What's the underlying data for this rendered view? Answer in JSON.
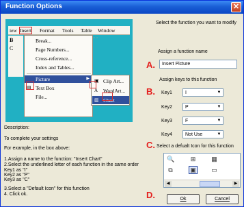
{
  "window": {
    "title": "Function Options",
    "close_glyph": "✕"
  },
  "preview": {
    "menubar": [
      "iew",
      "Insert",
      "Format",
      "Tools",
      "Table",
      "Window"
    ],
    "toolbar_left": [
      "B",
      "C"
    ],
    "menu_items": [
      "Break...",
      "Page Numbers...",
      "Cross-reference...",
      "Index and Tables...",
      "Picture",
      "Text Box",
      "File..."
    ],
    "submenu_items": [
      "Clip Art...",
      "WordArt...",
      "Chart"
    ]
  },
  "right": {
    "instruction": "Select the function you want to modify",
    "assign_name_label": "Assign a function name",
    "function_name_value": "Insert Picture",
    "assign_keys_label": "Assign keys to this function",
    "keys": [
      {
        "label": "Key1",
        "value": "I"
      },
      {
        "label": "Key2",
        "value": "P"
      },
      {
        "label": "Key3",
        "value": "F"
      },
      {
        "label": "Key4",
        "value": "Not Use"
      }
    ],
    "icon_label": "Select a defualt  Icon for this function",
    "letters": [
      "A.",
      "B.",
      "C.",
      "D."
    ],
    "ok_label": "Ok",
    "cancel_label": "Cancel"
  },
  "description": {
    "heading": "Description:",
    "line1": "To complete your settings",
    "line2": "For example, in the box above:",
    "steps": [
      "1.Assign a name to the function: \"Insert Chart\"",
      "2.Select the underlined letter of each function in the same order",
      "Key1 as \"I\"",
      "Key2 as \"P\"",
      "Key3 as \"C\"",
      "",
      "3.Select a \"Default Icon\" for this function",
      "4. Click ok."
    ]
  },
  "colors": {
    "accent_red": "#e4201e",
    "title_blue": "#0a46c4",
    "preview_teal": "#21b0c3"
  }
}
